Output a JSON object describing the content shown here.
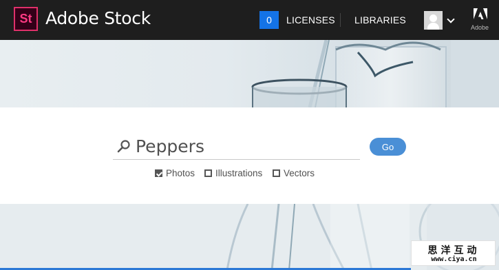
{
  "header": {
    "logo_text": "St",
    "app_title": "Adobe Stock",
    "licenses_count": "0",
    "licenses_label": "LICENSES",
    "libraries_label": "LIBRARIES",
    "adobe_label": "Adobe"
  },
  "search": {
    "query": "Peppers",
    "go_label": "Go",
    "filters": [
      {
        "label": "Photos",
        "checked": true
      },
      {
        "label": "Illustrations",
        "checked": false
      },
      {
        "label": "Vectors",
        "checked": false
      }
    ]
  },
  "watermark": {
    "line1": "思洋互动",
    "line2": "www.ciya.cn"
  },
  "colors": {
    "header_bg": "#1e1e1e",
    "logo_accent": "#ff3a84",
    "license_badge": "#1473e6",
    "go_button": "#4a8fd6"
  },
  "icons": {
    "search": "search-icon",
    "user": "avatar-icon",
    "menu": "chevron-down-icon",
    "brand": "adobe-logo-icon"
  }
}
